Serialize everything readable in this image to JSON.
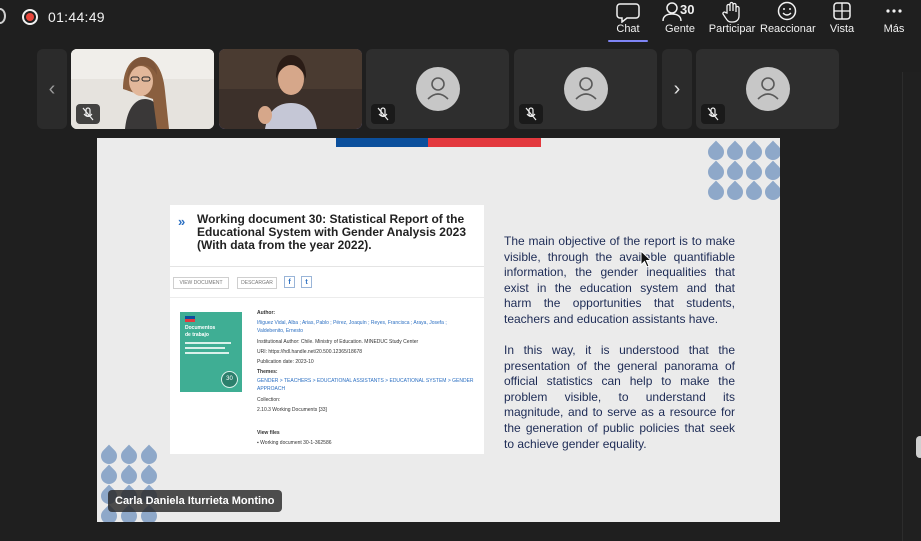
{
  "meeting": {
    "elapsed_time": "01:44:49"
  },
  "toolbar": {
    "chat_label": "Chat",
    "people_label": "Gente",
    "people_count": "30",
    "raise_hand_label": "Participar",
    "react_label": "Reaccionar",
    "view_label": "Vista",
    "more_label": "Más"
  },
  "strip": {
    "prev_arrow": "‹",
    "next_arrow": "›"
  },
  "presenter": {
    "name": "Carla Daniela Iturrieta Montino"
  },
  "slide": {
    "card": {
      "title": "Working document 30: Statistical Report of the Educational System with Gender Analysis 2023 (With data from the year 2022).",
      "view_document_label": "VIEW DOCUMENT",
      "share_label": "DESCARGAR",
      "facebook_glyph": "f",
      "twitter_glyph": "t",
      "cover_title_1": "Documentos",
      "cover_title_2": "de trabajo",
      "cover_number": "30",
      "author_heading": "Author:",
      "authors_line_1": "Iñiguez Vidal, Alba ; Arias, Pablo ; Pérez, Joaquín ; Reyes, Francisca ; Araya, Josefa ;",
      "authors_line_2": "Valdebenito, Ernesto",
      "institutional_author": "Institutional Author: Chile. Ministry of Education. MINEDUC Study Center",
      "uri": "URI: https://hdl.handle.net/20.500.12365/18678",
      "publication_date": "Publication date: 2023-10",
      "themes_heading": "Themes:",
      "themes_line_1": "GENDER > TEACHERS > EDUCATIONAL ASSISTANTS > EDUCATIONAL SYSTEM > GENDER",
      "themes_line_2": "APPROACH",
      "collection_heading": "Collection:",
      "collection_value": "2.10.3 Working Documents [33]",
      "view_files_label": "View files",
      "file_name": "Working document 30-1-362586"
    },
    "paragraphs": [
      "The main objective of the report is to make visible, through the available quantifiable information, the gender inequalities that exist in the education system and that harm the opportunities that students, teachers and education assistants have.",
      "In this way, it is understood that the presentation of the general panorama of official statistics can help to make the problem visible, to understand its magnitude, and to serve as a resource for the generation of public policies that seek to achieve gender equality."
    ]
  },
  "colors": {
    "accent": "#7f85f5",
    "recording_red": "#e8463b",
    "flag_blue": "#0b4f9c",
    "flag_red": "#e3393e",
    "slide_text": "#1d2b55",
    "decor_drops": "#8ea8c9",
    "cover_green": "#3fae94"
  }
}
